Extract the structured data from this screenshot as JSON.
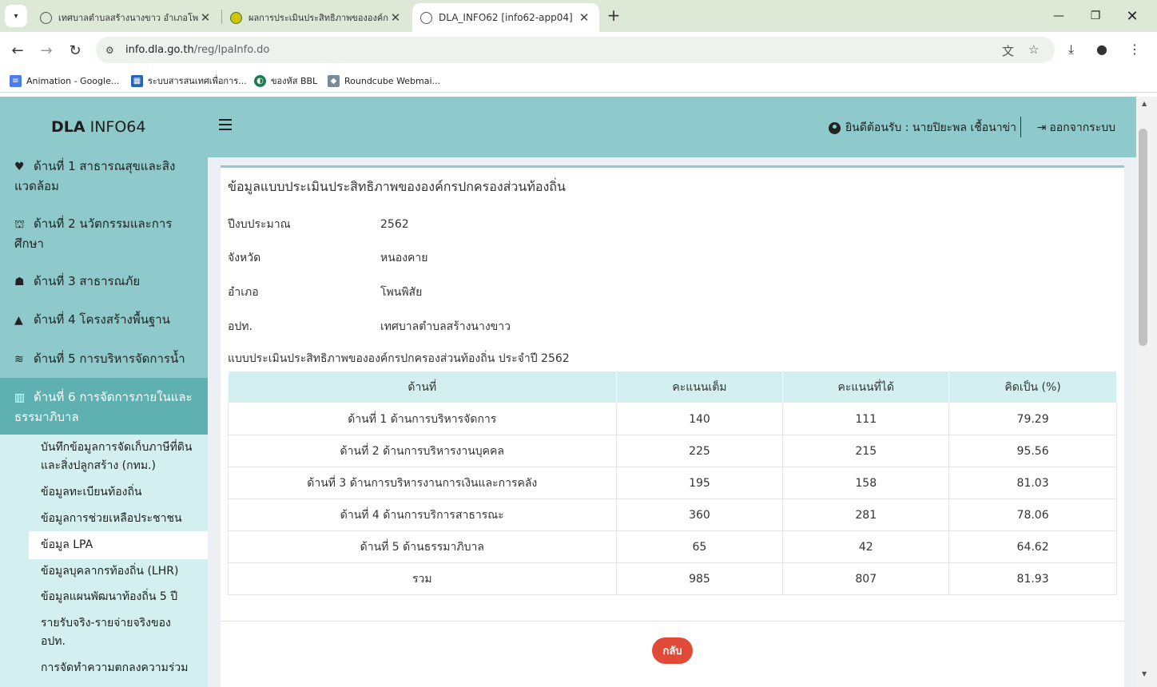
{
  "browser": {
    "tabs": [
      {
        "title": "เทศบาลตำบลสร้างนางขาว อำเภอโพนพิสัย",
        "close": "✕"
      },
      {
        "title": "ผลการประเมินประสิทธิภาพขององค์กรปกครองส่วนท้องถิ่น",
        "close": "✕"
      },
      {
        "title": "DLA_INFO62 [info62-app04]",
        "close": "✕"
      }
    ],
    "new_tab": "+",
    "url_host": "info.dla.go.th",
    "url_path": "/reg/lpaInfo.do",
    "bookmarks": [
      {
        "label": "Animation - Google..."
      },
      {
        "label": "ระบบสารสนเทศเพื่อการ..."
      },
      {
        "label": "ของหัส BBL"
      },
      {
        "label": "Roundcube Webmai..."
      }
    ]
  },
  "app": {
    "logo_bold": "DLA",
    "logo_rest": "INFO64",
    "welcome": "ยินดีต้อนรับ : นายปิยะพล เชื้อนาข่า",
    "logout": "ออกจากระบบ",
    "sidebar": {
      "items": [
        {
          "line1": "ด้านที่ 1 สาธารณสุขและสิง",
          "line2": "แวดล้อม"
        },
        {
          "line1": "ด้านที่ 2 นวัตกรรมและการ",
          "line2": "ศึกษา"
        },
        {
          "line1": "ด้านที่ 3 สาธารณภัย"
        },
        {
          "line1": "ด้านที่ 4 โครงสร้างพื้นฐาน"
        },
        {
          "line1": "ด้านที่ 5 การบริหารจัดการน้ำ"
        },
        {
          "line1": "ด้านที่ 6 การจัดการภายในและ",
          "line2": "ธรรมาภิบาล"
        }
      ],
      "subitems": [
        {
          "line1": "บันทึกข้อมูลการจัดเก็บภาษีที่ดิน",
          "line2": "และสิ่งปลูกสร้าง (กทม.)"
        },
        {
          "line1": "ข้อมูลทะเบียนท้องถิ่น"
        },
        {
          "line1": "ข้อมูลการช่วยเหลือประชาชน"
        },
        {
          "line1": "ข้อมูล LPA"
        },
        {
          "line1": "ข้อมูลบุคลากรท้องถิ่น (LHR)"
        },
        {
          "line1": "ข้อมูลแผนพัฒนาท้องถิ่น 5 ปี"
        },
        {
          "line1": "รายรับจริง-รายจ่ายจริงของ",
          "line2": "อปท."
        },
        {
          "line1": "การจัดทำความตกลงความร่วม"
        }
      ]
    }
  },
  "content": {
    "title": "ข้อมูลแบบประเมินประสิทธิภาพขององค์กรปกครองส่วนท้องถิ่น",
    "info": [
      {
        "label": "ปีงบประมาณ",
        "value": "2562"
      },
      {
        "label": "จังหวัด",
        "value": "หนองคาย"
      },
      {
        "label": "อำเภอ",
        "value": "โพนพิสัย"
      },
      {
        "label": "อปท.",
        "value": "เทศบาลตำบลสร้างนางขาว"
      }
    ],
    "table_caption": "แบบประเมินประสิทธิภาพขององค์กรปกครองส่วนท้องถิ่น ประจำปี 2562",
    "table": {
      "headers": [
        "ด้านที่",
        "คะแนนเต็ม",
        "คะแนนที่ได้",
        "คิดเป็น (%)"
      ],
      "rows": [
        [
          "ด้านที่ 1 ด้านการบริหารจัดการ",
          "140",
          "111",
          "79.29"
        ],
        [
          "ด้านที่ 2 ด้านการบริหารงานบุคคล",
          "225",
          "215",
          "95.56"
        ],
        [
          "ด้านที่ 3 ด้านการบริหารงานการเงินและการคลัง",
          "195",
          "158",
          "81.03"
        ],
        [
          "ด้านที่ 4 ด้านการบริการสาธารณะ",
          "360",
          "281",
          "78.06"
        ],
        [
          "ด้านที่ 5 ด้านธรรมาภิบาล",
          "65",
          "42",
          "64.62"
        ],
        [
          "รวม",
          "985",
          "807",
          "81.93"
        ]
      ]
    },
    "back_button": "กลับ"
  }
}
